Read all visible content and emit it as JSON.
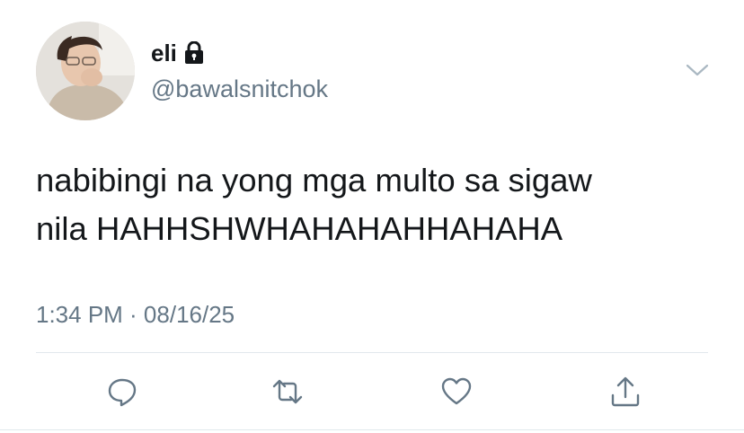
{
  "user": {
    "display_name": "eli",
    "handle": "@bawalsnitchok",
    "protected_icon": "lock-icon",
    "avatar_icon": "avatar"
  },
  "tweet": {
    "lines": [
      "nabibingi na yong mga multo sa sigaw",
      "nila HAHHSHWHAHAHAHHAHAHA"
    ],
    "timestamp": "1:34 PM · 08/16/25"
  },
  "actions": [
    {
      "icon": "reply-icon"
    },
    {
      "icon": "retweet-icon"
    },
    {
      "icon": "like-icon"
    },
    {
      "icon": "share-icon"
    }
  ],
  "menu_icon": "chevron-down-icon",
  "colors": {
    "text": "#14171a",
    "secondary": "#657786",
    "divider": "#e1e8ed",
    "background": "#ffffff"
  }
}
